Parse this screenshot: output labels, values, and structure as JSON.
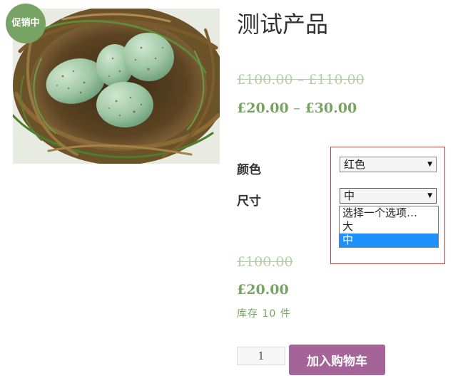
{
  "badge": {
    "text": "促销中"
  },
  "product": {
    "title": "测试产品",
    "image_icon": "bird-nest-eggs-photo"
  },
  "price_range": {
    "old": "£100.00 – £110.00",
    "new_min": "£20.00",
    "new_sep": "–",
    "new_max": "£30.00"
  },
  "variations": {
    "color": {
      "label": "颜色",
      "selected": "红色"
    },
    "size": {
      "label": "尺寸",
      "selected": "中",
      "options": [
        "选择一个选项…",
        "大",
        "中"
      ],
      "highlighted_option": "中"
    }
  },
  "variation_price": {
    "old": "£100.00",
    "new": "£20.00"
  },
  "stock": {
    "text": "库存 10 件"
  },
  "cart": {
    "quantity": "1",
    "add_label": "加入购物车"
  },
  "colors": {
    "accent_green": "#77a464",
    "faded_green": "#b1cfa4",
    "button_purple": "#a46497",
    "highlight_red": "#e03a3a",
    "option_selected_blue": "#1e90ff"
  }
}
